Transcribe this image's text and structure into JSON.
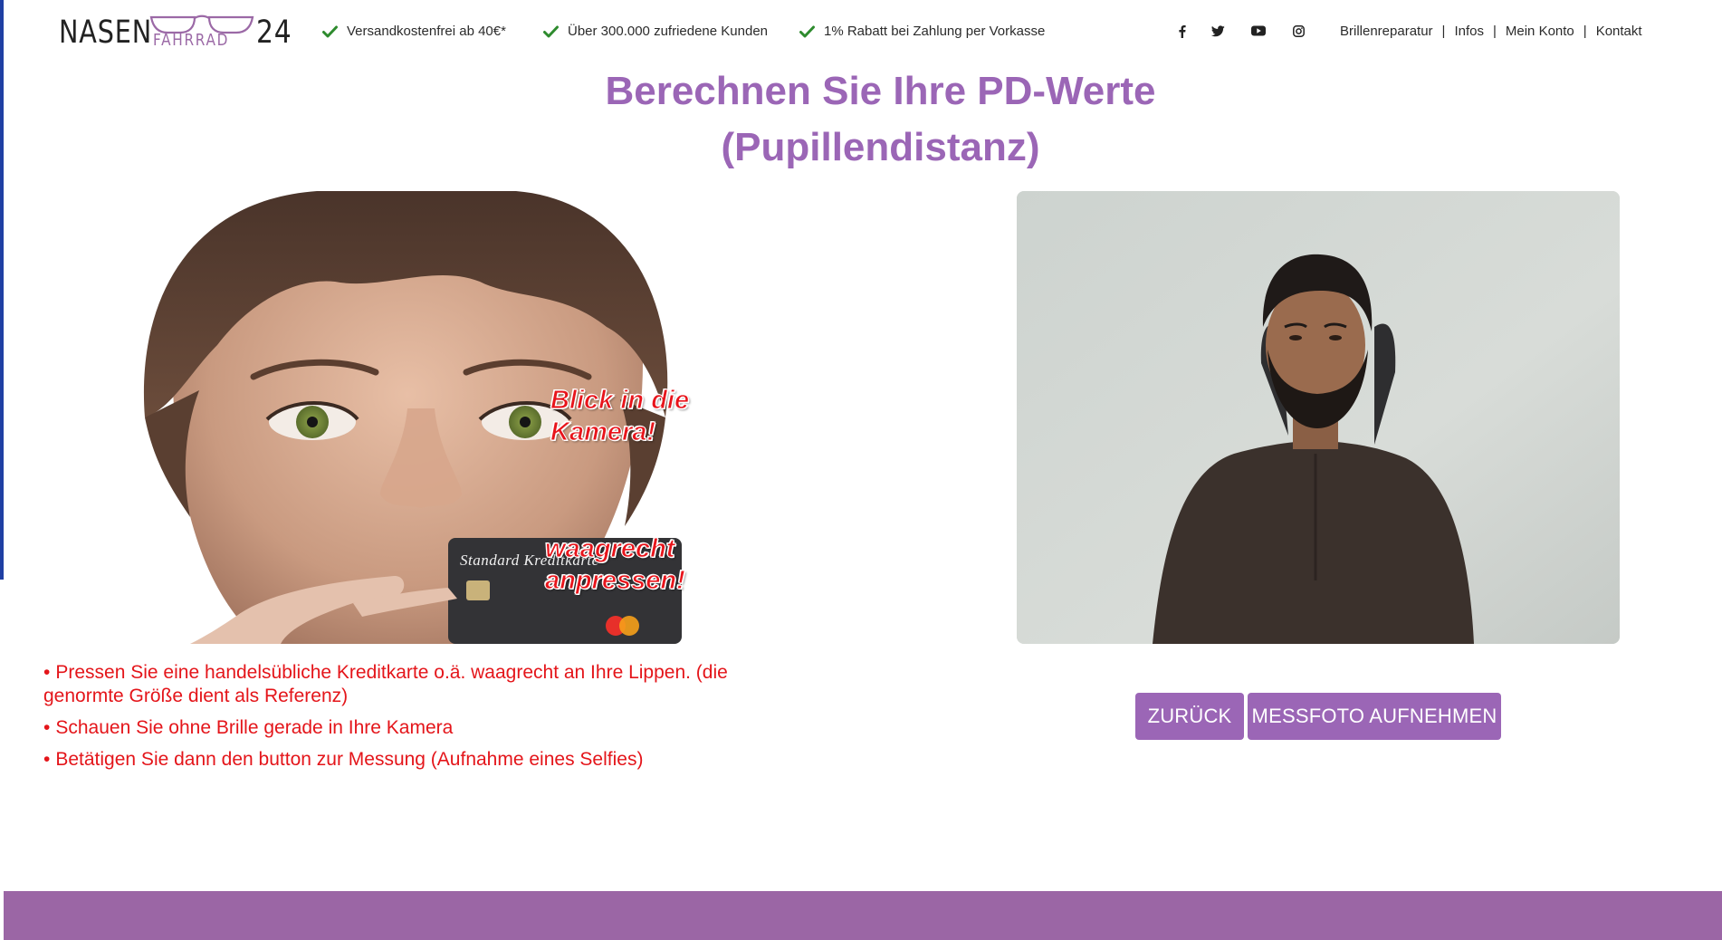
{
  "header": {
    "logo": {
      "word_left": "NASEN",
      "word_sub": "FAHRRAD",
      "number": "24",
      "icon": "glasses-icon"
    },
    "usps": [
      {
        "icon": "check-icon",
        "label": "Versandkostenfrei ab 40€*"
      },
      {
        "icon": "check-icon",
        "label": "Über 300.000 zufriedene Kunden"
      },
      {
        "icon": "check-icon",
        "label": "1% Rabatt bei Zahlung per Vorkasse"
      }
    ],
    "social": [
      "facebook-icon",
      "twitter-icon",
      "youtube-icon",
      "instagram-icon"
    ],
    "nav": [
      {
        "label": "Brillenreparatur"
      },
      {
        "label": "Infos"
      },
      {
        "label": "Mein Konto"
      },
      {
        "label": "Kontakt"
      }
    ],
    "separator": "|"
  },
  "page": {
    "title_line1": "Berechnen Sie Ihre PD-Werte",
    "title_line2": "(Pupillendistanz)"
  },
  "demo_image": {
    "caption_top": "Blick in die\nKamera!",
    "caption_bottom": "waagrecht\nanpressen!",
    "card_text": "Standard Kreditkarte"
  },
  "instructions": [
    "Pressen Sie eine handelsübliche Kreditkarte o.ä. waagrecht an Ihre Lippen. (die genormte Größe dient als Referenz)",
    "Schauen Sie ohne Brille gerade in Ihre Kamera",
    "Betätigen Sie dann den button zur Messung (Aufnahme eines Selfies)"
  ],
  "buttons": {
    "back": "ZURÜCK",
    "capture": "MESSFOTO AUFNEHMEN"
  },
  "colors": {
    "accent": "#9b66b6",
    "footer": "#9b66a5",
    "instruction_text": "#e4151a",
    "check": "#2e8b2e"
  }
}
